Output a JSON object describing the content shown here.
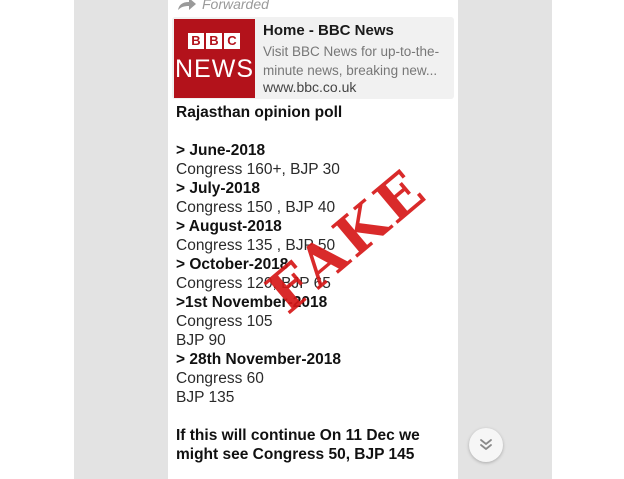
{
  "forwarded_label": "Forwarded",
  "link_preview": {
    "logo_letters": [
      "B",
      "B",
      "C"
    ],
    "logo_word": "NEWS",
    "title": "Home - BBC News",
    "description": "Visit BBC News for up-to-the-minute news, breaking new...",
    "url": "www.bbc.co.uk"
  },
  "message": {
    "heading": "Rajasthan opinion poll",
    "lines": [
      {
        "text": "> June-2018",
        "bold": true
      },
      {
        "text": "Congress 160+, BJP 30",
        "bold": false
      },
      {
        "text": "> July-2018",
        "bold": true
      },
      {
        "text": "Congress 150 , BJP 40",
        "bold": false
      },
      {
        "text": "> August-2018",
        "bold": true
      },
      {
        "text": "Congress 135 , BJP 50",
        "bold": false
      },
      {
        "text": "> October-2018",
        "bold": true
      },
      {
        "text": "Congress 120, BJP 65",
        "bold": false
      },
      {
        "text": ">1st November-2018",
        "bold": true
      },
      {
        "text": "Congress 105",
        "bold": false
      },
      {
        "text": "BJP 90",
        "bold": false
      },
      {
        "text": "> 28th November-2018",
        "bold": true
      },
      {
        "text": "Congress 60",
        "bold": false
      },
      {
        "text": "BJP 135",
        "bold": false
      }
    ],
    "footer": "If this will continue On 11 Dec we might see Congress 50, BJP 145"
  },
  "stamp_text": "FAKE",
  "colors": {
    "stamp": "#d61818",
    "bbc_red": "#b3121b",
    "side_panel": "#e3e3e3"
  },
  "icons": {
    "forward": "forward-arrow-icon",
    "scroll_down": "double-chevron-down-icon"
  }
}
